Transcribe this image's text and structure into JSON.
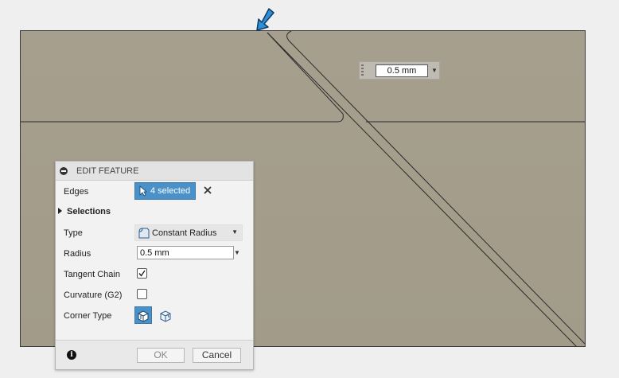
{
  "viewport": {
    "radius_manipulator": {
      "value": "0.5 mm"
    },
    "cursor_icon": "blue-arrow-cursor-icon"
  },
  "panel": {
    "title": "EDIT FEATURE",
    "edges": {
      "label": "Edges",
      "button_label": "4 selected",
      "clear_icon": "close-icon",
      "pointer_icon": "arrow-pointer-icon"
    },
    "selections": {
      "label": "Selections",
      "expanded": false
    },
    "type": {
      "label": "Type",
      "value": "Constant Radius",
      "icon": "fillet-icon"
    },
    "radius": {
      "label": "Radius",
      "value": "0.5 mm"
    },
    "tangent_chain": {
      "label": "Tangent Chain",
      "checked": true
    },
    "curvature": {
      "label": "Curvature (G2)",
      "checked": false
    },
    "corner_type": {
      "label": "Corner Type",
      "options": [
        "rolling-ball-corner-icon",
        "setback-corner-icon"
      ],
      "selected": 0
    },
    "footer": {
      "ok_label": "OK",
      "cancel_label": "Cancel",
      "info_icon": "info-icon"
    }
  },
  "colors": {
    "accent": "#4a90c9",
    "viewport": "#a69f8e",
    "panel_bg": "#f2f2f2"
  }
}
